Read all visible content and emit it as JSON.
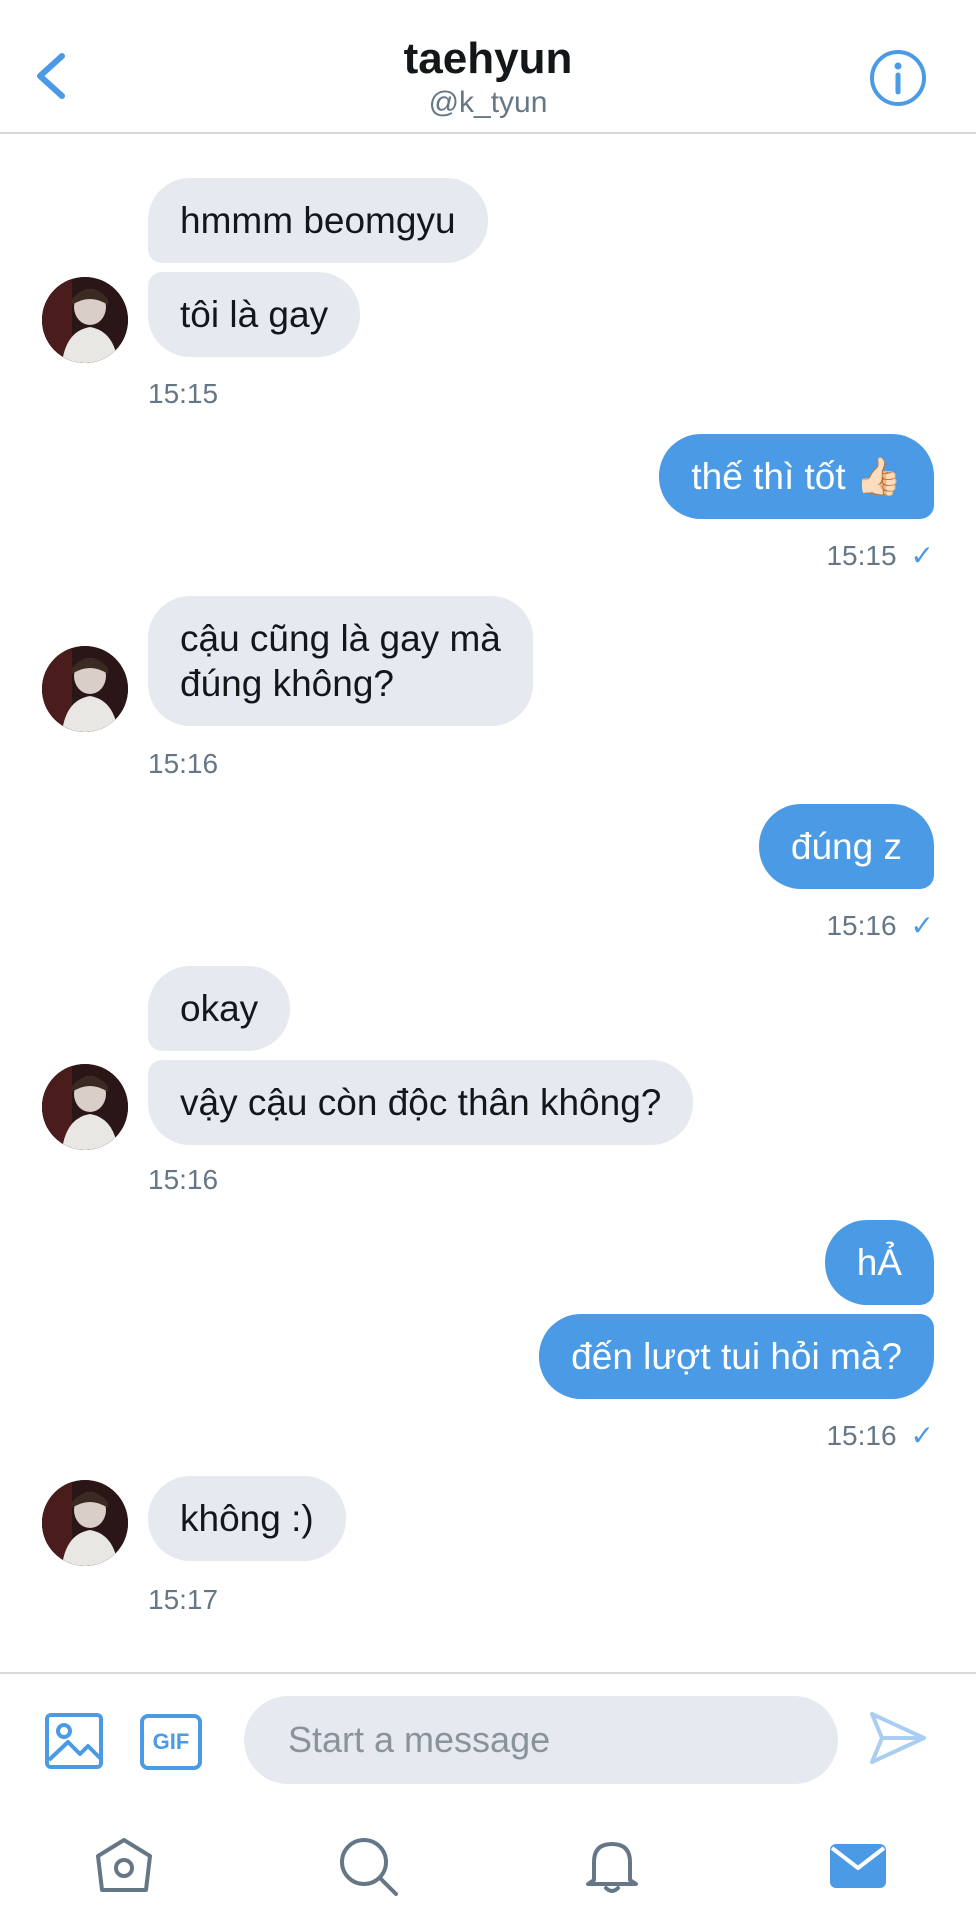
{
  "header": {
    "title": "taehyun",
    "handle": "@k_tyun",
    "back_icon": "chevron-left-icon",
    "info_icon": "info-icon"
  },
  "messages": [
    {
      "side": "in",
      "text": "hmmm beomgyu"
    },
    {
      "side": "in",
      "text": "tôi là gay",
      "time": "15:15"
    },
    {
      "side": "out",
      "text": "thế thì tốt 👍🏻",
      "time": "15:15",
      "status": "✓"
    },
    {
      "side": "in",
      "text_line1": "cậu cũng là gay mà",
      "text_line2": "đúng không?",
      "time": "15:16"
    },
    {
      "side": "out",
      "text": "đúng z",
      "time": "15:16",
      "status": "✓"
    },
    {
      "side": "in",
      "text": "okay"
    },
    {
      "side": "in",
      "text": "vậy cậu còn độc thân không?",
      "time": "15:16"
    },
    {
      "side": "out",
      "text": "hẢ"
    },
    {
      "side": "out",
      "text": "đến lượt tui hỏi mà?",
      "time": "15:16",
      "status": "✓"
    },
    {
      "side": "in",
      "text": "không :)",
      "time": "15:17"
    }
  ],
  "composer": {
    "placeholder": "Start a message",
    "image_icon": "image-icon",
    "gif_label": "GIF",
    "send_icon": "send-icon"
  },
  "tabbar": {
    "items": [
      "home-icon",
      "search-icon",
      "notifications-icon",
      "messages-icon"
    ],
    "active": "messages-icon"
  },
  "colors": {
    "accent": "#4a9ae6",
    "incoming_bubble": "#e6e9f0",
    "secondary_text": "#657786"
  }
}
